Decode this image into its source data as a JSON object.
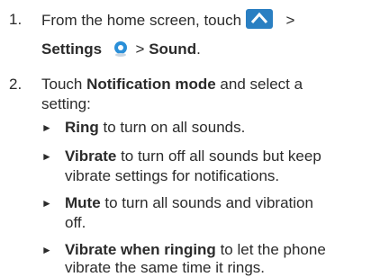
{
  "step1": {
    "number": "1.",
    "text_a": "From the home screen, touch",
    "sep1": ">",
    "settings": "Settings",
    "sep2": ">",
    "sound": "Sound",
    "end": "."
  },
  "step2": {
    "number": "2.",
    "touch": "Touch",
    "mode": "Notification mode",
    "rest_a": "and select a",
    "rest_b": "setting:"
  },
  "options": [
    {
      "term": "Ring",
      "desc_1": "to turn on all sounds.",
      "desc_2": ""
    },
    {
      "term": "Vibrate",
      "desc_1": "to turn off all sounds but keep",
      "desc_2": "vibrate settings for notifications."
    },
    {
      "term": "Mute",
      "desc_1": "to turn all sounds and vibration",
      "desc_2": "off."
    },
    {
      "term": "Vibrate when ringing",
      "desc_1": "to let the phone",
      "desc_2": "vibrate the same time it rings."
    }
  ],
  "icons": {
    "home": "apps-up-arrow-icon",
    "settings": "settings-gear-icon",
    "bullet": "triangle-bullet-icon"
  },
  "colors": {
    "text": "#2b2b2b",
    "accent": "#2a7fc2",
    "gear": "#2a8fd8"
  }
}
